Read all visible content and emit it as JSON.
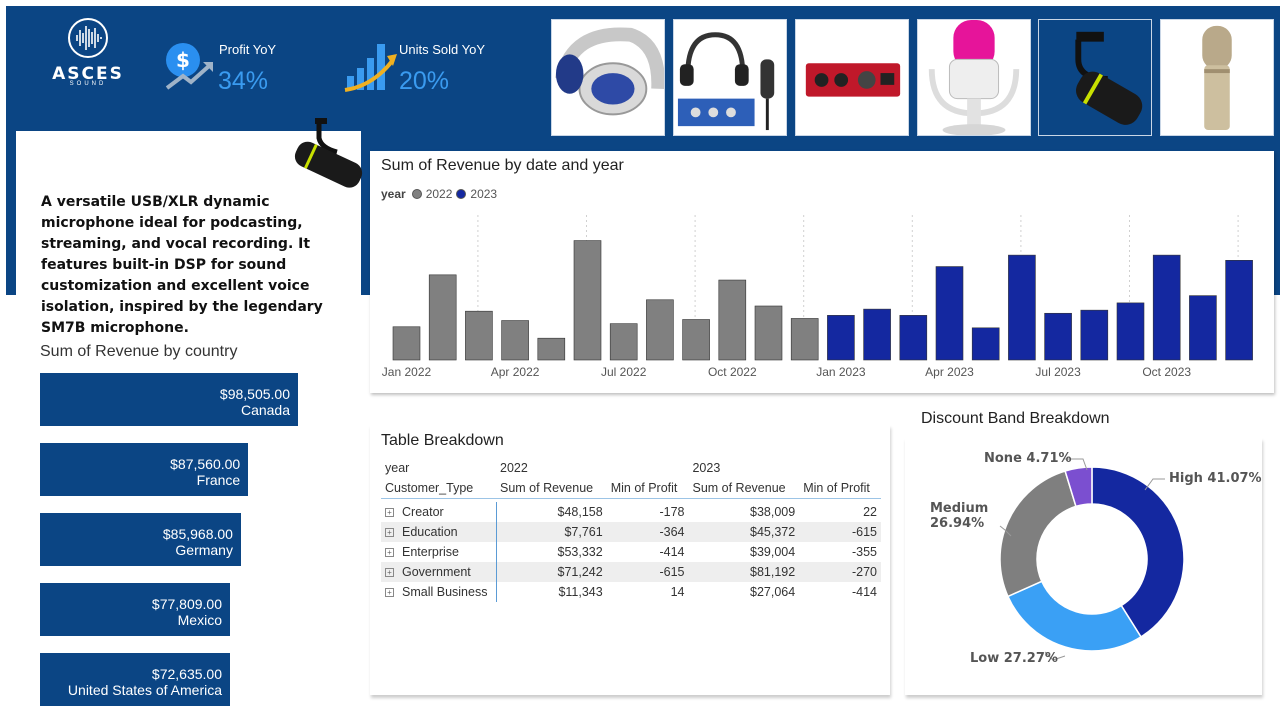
{
  "brand": {
    "name": "ASCES",
    "sub": "SOUND"
  },
  "kpis": [
    {
      "label": "Profit YoY",
      "value": "34%",
      "icon": "dollar-growth-icon"
    },
    {
      "label": "Units Sold YoY",
      "value": "20%",
      "icon": "bar-growth-icon"
    }
  ],
  "thumbnails": [
    "headphones-silver-blue-icon",
    "studio-bundle-icon",
    "audio-interface-red-icon",
    "usb-microphone-white-icon",
    "dynamic-microphone-black-icon",
    "condenser-microphone-icon"
  ],
  "product_description": "A versatile USB/XLR dynamic microphone ideal for podcasting, streaming, and vocal recording. It features built-in DSP for sound customization and excellent voice isolation, inspired by the legendary SM7B microphone.",
  "country_chart": {
    "title": "Sum of Revenue by country",
    "items": [
      {
        "value": "$98,505.00",
        "country": "Canada",
        "amount": 98505
      },
      {
        "value": "$87,560.00",
        "country": "France",
        "amount": 87560
      },
      {
        "value": "$85,968.00",
        "country": "Germany",
        "amount": 85968
      },
      {
        "value": "$77,809.00",
        "country": "Mexico",
        "amount": 77809
      },
      {
        "value": "$72,635.00",
        "country": "United States of America",
        "amount": 72635
      }
    ]
  },
  "revenue_chart": {
    "title": "Sum of Revenue by date and year",
    "legend_title": "year",
    "legend": [
      {
        "name": "2022",
        "color": "#808080"
      },
      {
        "name": "2023",
        "color": "#1428a0"
      }
    ]
  },
  "chart_data": {
    "type": "bar",
    "title": "Sum of Revenue by date and year",
    "x_tick_labels": [
      "Jan 2022",
      "Apr 2022",
      "Jul 2022",
      "Oct 2022",
      "Jan 2023",
      "Apr 2023",
      "Jul 2023",
      "Oct 2023"
    ],
    "series": [
      {
        "name": "2022",
        "color": "#808080",
        "values": [
          32,
          82,
          47,
          38,
          21,
          115,
          35,
          58,
          39,
          77,
          52,
          40
        ]
      },
      {
        "name": "2023",
        "color": "#1428a0",
        "values": [
          43,
          49,
          43,
          90,
          31,
          101,
          45,
          48,
          55,
          101,
          62,
          96
        ]
      }
    ],
    "ylim": [
      0,
      130
    ],
    "grid": "vertical-dotted"
  },
  "table": {
    "title": "Table Breakdown",
    "row_header_1": "year",
    "row_header_2": "Customer_Type",
    "years": [
      "2022",
      "2023"
    ],
    "columns": [
      "Sum of Revenue",
      "Min of Profit",
      "Sum of Revenue",
      "Min of Profit"
    ],
    "rows": [
      {
        "type": "Creator",
        "rev22": "$48,158",
        "min22": "-178",
        "rev23": "$38,009",
        "min23": "22"
      },
      {
        "type": "Education",
        "rev22": "$7,761",
        "min22": "-364",
        "rev23": "$45,372",
        "min23": "-615"
      },
      {
        "type": "Enterprise",
        "rev22": "$53,332",
        "min22": "-414",
        "rev23": "$39,004",
        "min23": "-355"
      },
      {
        "type": "Government",
        "rev22": "$71,242",
        "min22": "-615",
        "rev23": "$81,192",
        "min23": "-270"
      },
      {
        "type": "Small Business",
        "rev22": "$11,343",
        "min22": "14",
        "rev23": "$27,064",
        "min23": "-414"
      }
    ]
  },
  "donut": {
    "title": "Discount Band Breakdown",
    "slices": [
      {
        "label": "High 41.07%",
        "pct": 41.07,
        "color": "#1428a0"
      },
      {
        "label": "Low 27.27%",
        "pct": 27.27,
        "color": "#3aa0f5"
      },
      {
        "label": "Medium\n26.94%",
        "pct": 26.94,
        "color": "#7f7f7f"
      },
      {
        "label": "None 4.71%",
        "pct": 4.71,
        "color": "#7b4fd0"
      }
    ]
  }
}
